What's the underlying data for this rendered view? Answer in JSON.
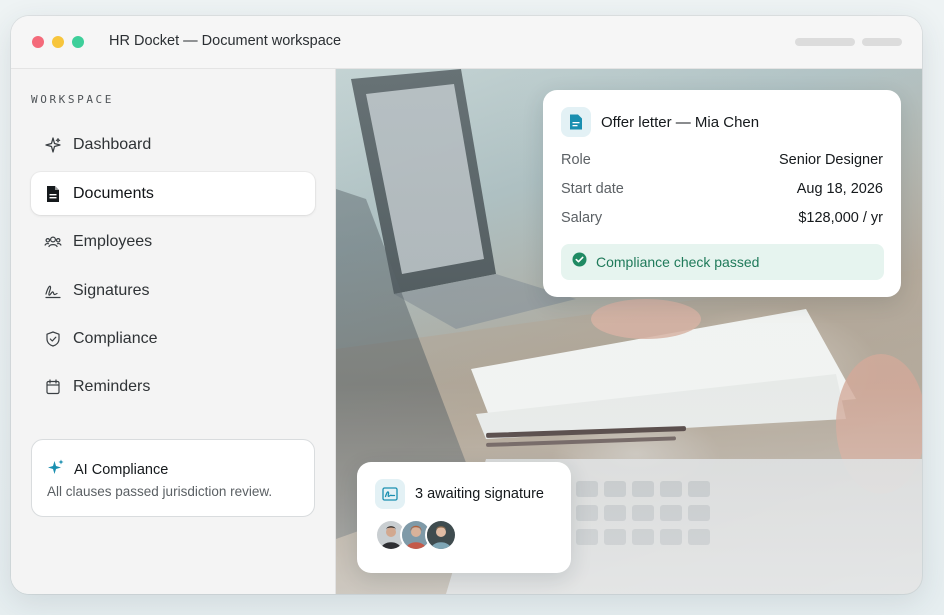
{
  "window": {
    "title": "HR Docket — Document workspace"
  },
  "sidebar": {
    "section_label": "WORKSPACE",
    "items": [
      {
        "label": "Dashboard",
        "icon": "sparkle-icon",
        "active": false
      },
      {
        "label": "Documents",
        "icon": "document-icon",
        "active": true
      },
      {
        "label": "Employees",
        "icon": "people-icon",
        "active": false
      },
      {
        "label": "Signatures",
        "icon": "signature-icon",
        "active": false
      },
      {
        "label": "Compliance",
        "icon": "shield-check-icon",
        "active": false
      },
      {
        "label": "Reminders",
        "icon": "calendar-icon",
        "active": false
      }
    ],
    "ai_card": {
      "title": "AI Compliance",
      "description": "All clauses passed jurisdiction review.",
      "icon": "sparkle-icon"
    }
  },
  "offer_card": {
    "title": "Offer letter — Mia Chen",
    "icon": "document-icon",
    "rows": [
      {
        "key": "Role",
        "value": "Senior Designer"
      },
      {
        "key": "Start date",
        "value": "Aug 18, 2026"
      },
      {
        "key": "Salary",
        "value": "$128,000 / yr"
      }
    ],
    "compliance": {
      "text": "Compliance check passed",
      "icon": "check-circle-icon"
    }
  },
  "signature_card": {
    "title": "3 awaiting signature",
    "icon": "signature-doc-icon",
    "avatars": [
      "avatar",
      "avatar",
      "avatar"
    ]
  },
  "colors": {
    "accent": "#1a8fb0",
    "success": "#1f7a5a",
    "success_bg": "#e6f4ef",
    "dot_red": "#f46a7a",
    "dot_yellow": "#f7c53c",
    "dot_green": "#3ecf9a"
  }
}
